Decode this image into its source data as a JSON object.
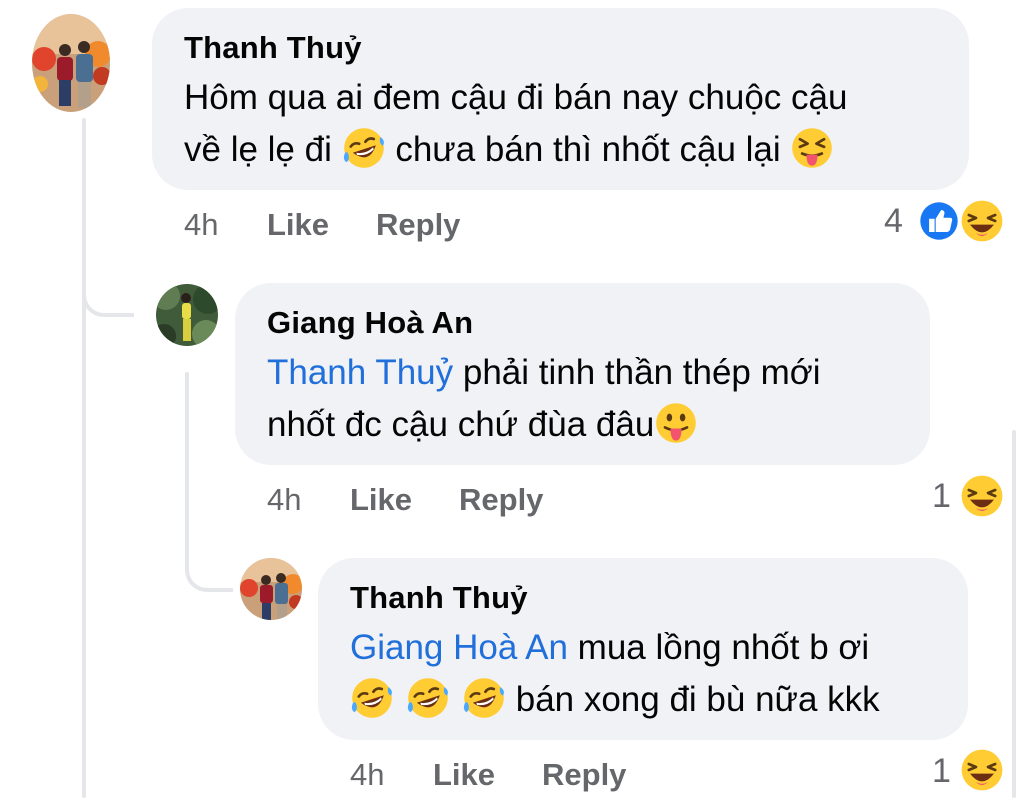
{
  "comments": [
    {
      "author": "Thanh Thuỷ",
      "line1": "Hôm qua ai đem cậu đi bán nay chuộc cậu",
      "line2_a": "về lẹ lẹ đi ",
      "line2_b": " chưa bán thì nhốt cậu lại ",
      "time": "4h",
      "like_label": "Like",
      "reply_label": "Reply",
      "reaction_count": "4",
      "reactions": [
        "like-reaction-icon",
        "haha-reaction-icon"
      ]
    },
    {
      "author": "Giang Hoà An",
      "mention": "Thanh Thuỷ",
      "line1": " phải tinh thần thép mới",
      "line2": "nhốt đc cậu chứ đùa đâu",
      "time": "4h",
      "like_label": "Like",
      "reply_label": "Reply",
      "reaction_count": "1",
      "reactions": [
        "haha-reaction-icon"
      ]
    },
    {
      "author": "Thanh Thuỷ",
      "mention": "Giang Hoà An",
      "line1": " mua lồng nhốt b ơi",
      "line2": " bán xong đi bù nữa kkk",
      "time": "4h",
      "like_label": "Like",
      "reply_label": "Reply",
      "reaction_count": "1",
      "reactions": [
        "haha-reaction-icon"
      ]
    }
  ],
  "colors": {
    "bubble": "#f0f2f5",
    "meta_text": "#65676b",
    "mention": "#216fdb",
    "like_blue": "#1877f2",
    "thread_line": "#e4e6ea"
  }
}
